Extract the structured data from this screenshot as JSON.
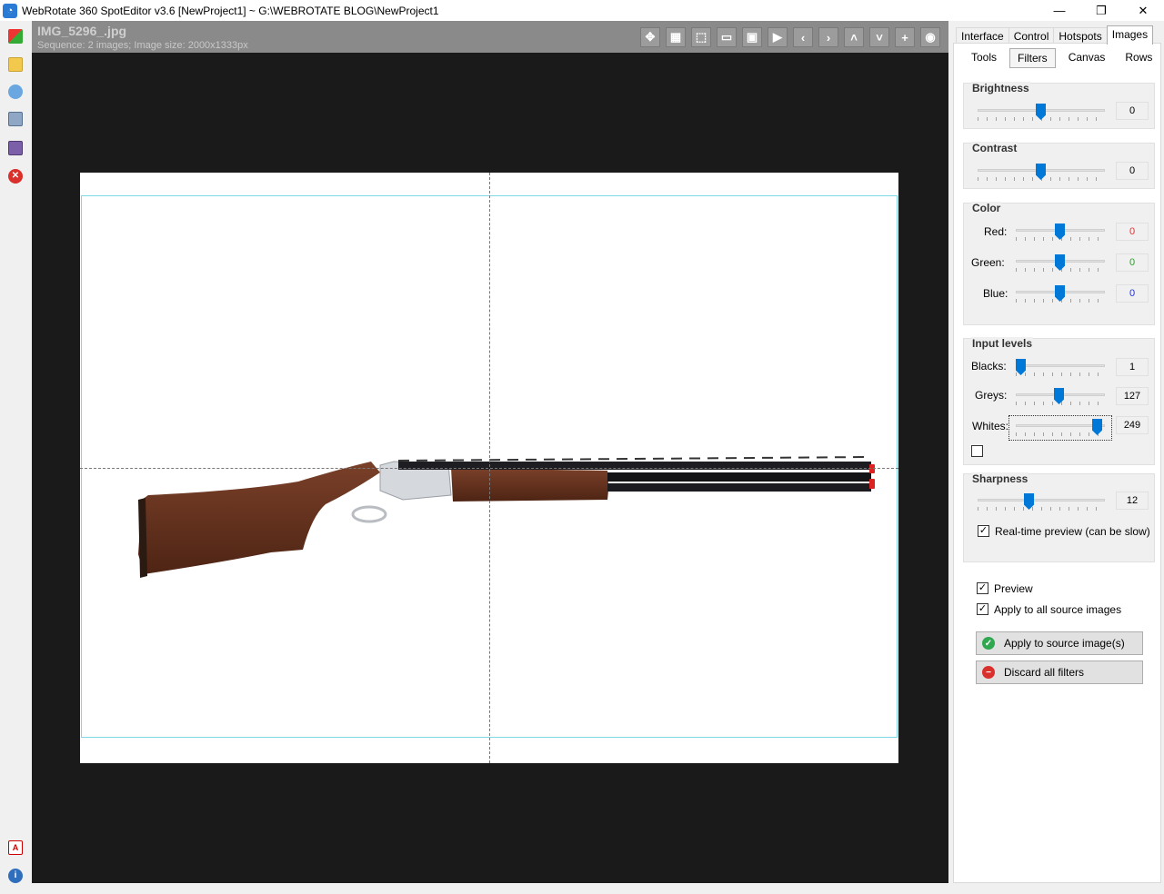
{
  "window": {
    "title": "WebRotate 360 SpotEditor v3.6 [NewProject1] ~ G:\\WEBROTATE BLOG\\NewProject1",
    "app_icon": "360-logo-icon"
  },
  "viewer": {
    "image_title": "IMG_5296_.jpg",
    "image_info": "Sequence: 2 images; Image size: 2000x1333px",
    "toolbar_icons": [
      "move-icon",
      "grid-icon",
      "select-icon",
      "fit-icon",
      "frame-icon",
      "play-icon",
      "prev-icon",
      "next-icon",
      "up-icon",
      "down-icon",
      "add-icon",
      "record-icon"
    ]
  },
  "left_toolbar": {
    "icons": [
      "add-project-icon",
      "open-folder-icon",
      "publish-icon",
      "print-icon",
      "save-icon",
      "close-icon",
      "pdf-icon",
      "info-icon"
    ]
  },
  "panel": {
    "tabs": [
      "Interface",
      "Control",
      "Hotspots",
      "Images"
    ],
    "active_tab": "Images",
    "subtabs": [
      "Tools",
      "Filters",
      "Canvas",
      "Rows"
    ],
    "active_subtab": "Filters",
    "brightness": {
      "title": "Brightness",
      "value": "0",
      "level": 0.5
    },
    "contrast": {
      "title": "Contrast",
      "value": "0",
      "level": 0.5
    },
    "color": {
      "title": "Color",
      "red_label": "Red:",
      "red_value": "0",
      "red_color": "#e03030",
      "green_label": "Green:",
      "green_value": "0",
      "green_color": "#2aa02a",
      "blue_label": "Blue:",
      "blue_value": "0",
      "blue_color": "#2030e0"
    },
    "input_levels": {
      "title": "Input levels",
      "blacks_label": "Blacks:",
      "blacks_value": "1",
      "greys_label": "Greys:",
      "greys_value": "127",
      "whites_label": "Whites:",
      "whites_value": "249"
    },
    "sharpness": {
      "title": "Sharpness",
      "value": "12",
      "realtime_label": "Real-time preview (can be slow)",
      "realtime_checked": true
    },
    "preview_label": "Preview",
    "preview_checked": true,
    "apply_all_label": "Apply to all source images",
    "apply_all_checked": true,
    "apply_button": "Apply to source image(s)",
    "discard_button": "Discard all filters",
    "accent": "#0078d7"
  }
}
